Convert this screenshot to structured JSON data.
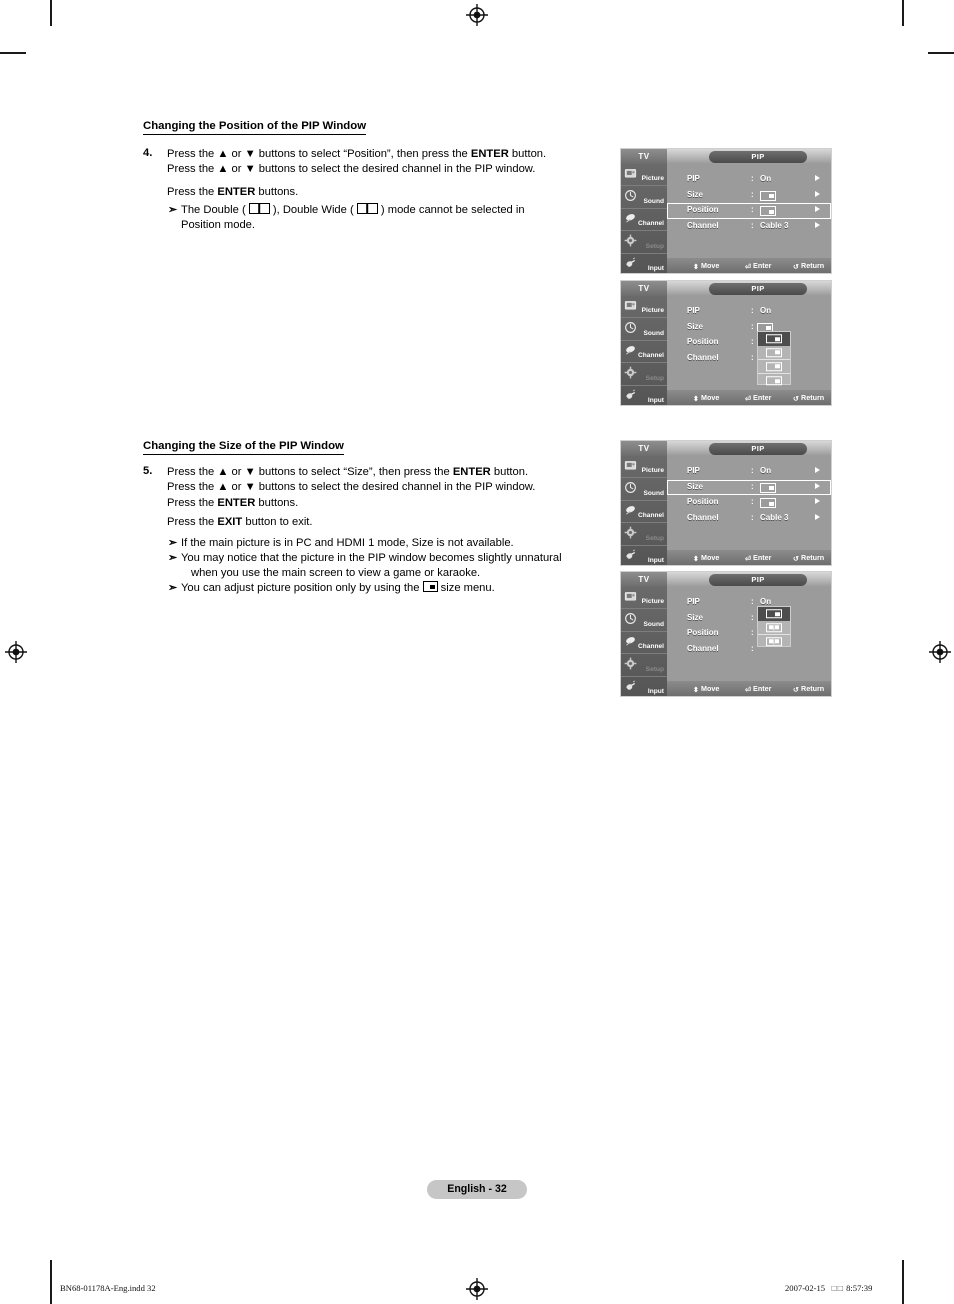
{
  "page": {
    "badge": "English - 32",
    "footer_left": "BN68-01178A-Eng.indd   32",
    "footer_date": "2007-02-15",
    "footer_cjk": "□□",
    "footer_time": "8:57:39"
  },
  "section1": {
    "heading": "Changing the Position of the PIP Window",
    "step_num": "4.",
    "line1_a": "Press the ",
    "line1_up": "▲",
    "line1_b": " or ",
    "line1_dn": "▼",
    "line1_c": " buttons to select “Position”, then press the ",
    "line1_enter": "ENTER",
    "line1_d": " button.",
    "line2_a": "Press the ",
    "line2_b": " or ",
    "line2_c": " buttons to select the desired channel in the PIP window.",
    "line3_a": "Press the ",
    "line3_enter": "ENTER",
    "line3_b": " buttons.",
    "bullet_glyph": "➣",
    "bullet_a": "The Double ( ",
    "bullet_b": " ), Double Wide ( ",
    "bullet_c": " ) mode cannot be selected in",
    "bullet_d": "Position mode."
  },
  "section2": {
    "heading": "Changing the Size of the PIP Window",
    "step_num": "5.",
    "line1_a": "Press the ",
    "line1_b": " or ",
    "line1_c": " buttons to select “Size”, then press the ",
    "line1_enter": "ENTER",
    "line1_d": " button.",
    "line2_c": " buttons to select the desired channel in the PIP window.",
    "line3_a": "Press the ",
    "line3_enter": "ENTER",
    "line3_b": " buttons.",
    "line4_a": "Press the ",
    "line4_exit": "EXIT",
    "line4_b": " button to exit.",
    "bullet_glyph": "➣",
    "bullet1": "If the main picture is in PC and HDMI 1 mode, Size is not available.",
    "bullet2_l1": "You may notice that the picture in the PIP window becomes slightly unnatural",
    "bullet2_l2": "when you use the main screen to view a game or karaoke.",
    "bullet3_a": "You can adjust picture position only by using the ",
    "bullet3_b": " size menu."
  },
  "osd_common": {
    "tv_label": "TV",
    "title": "PIP",
    "sidebar": [
      {
        "label": "Picture",
        "icon": "picture-icon",
        "dim": false
      },
      {
        "label": "Sound",
        "icon": "sound-icon",
        "dim": false
      },
      {
        "label": "Channel",
        "icon": "channel-icon",
        "dim": false
      },
      {
        "label": "Setup",
        "icon": "setup-icon",
        "dim": true
      },
      {
        "label": "Input",
        "icon": "input-icon",
        "dim": false
      }
    ],
    "bottom": {
      "move": "Move",
      "enter": "Enter",
      "return": "Return"
    },
    "colon": ":"
  },
  "osd1": {
    "rows": [
      {
        "label": "PIP",
        "value": "On",
        "type": "text",
        "arrow": true,
        "selected": false
      },
      {
        "label": "Size",
        "value": "",
        "type": "glyph",
        "arrow": true,
        "selected": false
      },
      {
        "label": "Position",
        "value": "",
        "type": "glyph",
        "arrow": true,
        "selected": true
      },
      {
        "label": "Channel",
        "value": "Cable 3",
        "type": "text",
        "arrow": true,
        "selected": false
      }
    ]
  },
  "osd2": {
    "rows": [
      {
        "label": "PIP",
        "value": "On",
        "type": "text",
        "arrow": false,
        "selected": false
      },
      {
        "label": "Size",
        "value": "",
        "type": "glyph",
        "arrow": false,
        "selected": false
      },
      {
        "label": "Position",
        "value": "",
        "type": "none",
        "arrow": false,
        "selected": false
      },
      {
        "label": "Channel",
        "value": "",
        "type": "none",
        "arrow": false,
        "selected": false
      }
    ],
    "dropdown": [
      {
        "corner": "br",
        "active": true
      },
      {
        "corner": "tr",
        "active": false
      },
      {
        "corner": "tr",
        "active": false
      },
      {
        "corner": "br",
        "active": false
      }
    ]
  },
  "osd3": {
    "rows": [
      {
        "label": "PIP",
        "value": "On",
        "type": "text",
        "arrow": true,
        "selected": false
      },
      {
        "label": "Size",
        "value": "",
        "type": "glyph",
        "arrow": true,
        "selected": true
      },
      {
        "label": "Position",
        "value": "",
        "type": "glyph",
        "arrow": true,
        "selected": false
      },
      {
        "label": "Channel",
        "value": "Cable 3",
        "type": "text",
        "arrow": true,
        "selected": false
      }
    ]
  },
  "osd4": {
    "rows": [
      {
        "label": "PIP",
        "value": "On",
        "type": "text",
        "arrow": false,
        "selected": false
      },
      {
        "label": "Size",
        "value": "",
        "type": "none",
        "arrow": false,
        "selected": false
      },
      {
        "label": "Position",
        "value": "",
        "type": "none",
        "arrow": false,
        "selected": false
      },
      {
        "label": "Channel",
        "value": "",
        "type": "none",
        "arrow": false,
        "selected": false
      }
    ],
    "dropdown": [
      {
        "style": "pip",
        "active": true
      },
      {
        "style": "split",
        "active": false
      },
      {
        "style": "split",
        "active": false
      }
    ]
  }
}
